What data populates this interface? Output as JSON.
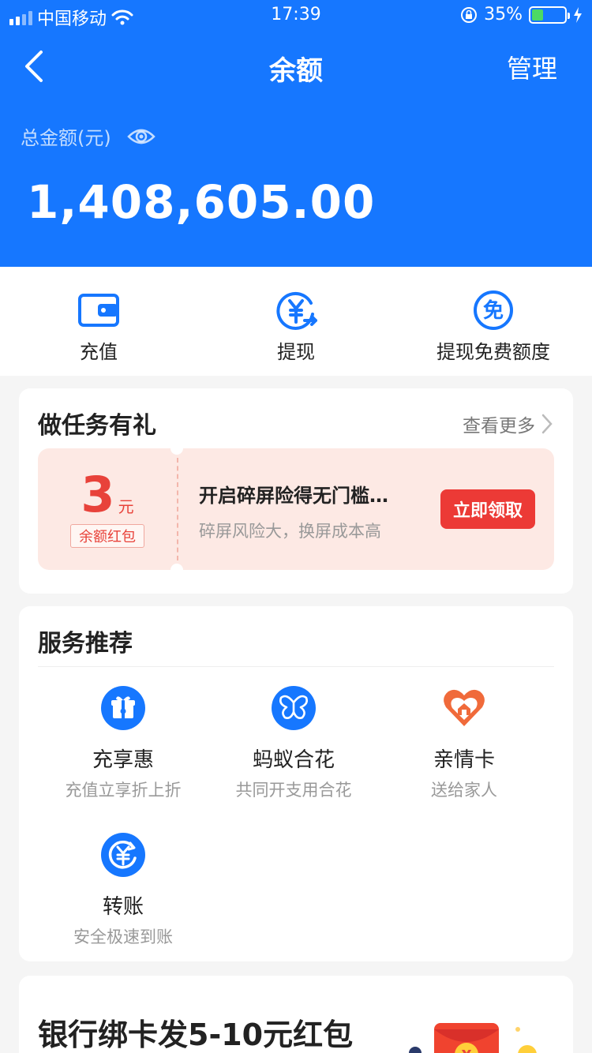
{
  "status_bar": {
    "carrier": "中国移动",
    "time": "17:39",
    "battery_percent": "35%",
    "battery_level": 0.35
  },
  "nav": {
    "title": "余额",
    "manage_label": "管理"
  },
  "balance": {
    "label": "总金额(元)",
    "amount": "1,408,605.00"
  },
  "actions": [
    {
      "label": "充值",
      "icon": "wallet-icon"
    },
    {
      "label": "提现",
      "icon": "yuan-withdraw-icon"
    },
    {
      "label": "提现免费额度",
      "icon": "free-icon"
    }
  ],
  "tasks": {
    "title": "做任务有礼",
    "more_label": "查看更多",
    "coupon": {
      "amount": "3",
      "unit": "元",
      "tag": "余额红包",
      "title": "开启碎屏险得无门槛…",
      "subtitle": "碎屏风险大，换屏成本高",
      "button": "立即领取"
    }
  },
  "services": {
    "title": "服务推荐",
    "items": [
      {
        "name": "充享惠",
        "desc": "充值立享折上折",
        "icon": "gift-icon",
        "color": "#1677ff"
      },
      {
        "name": "蚂蚁合花",
        "desc": "共同开支用合花",
        "icon": "butterfly-icon",
        "color": "#1677ff"
      },
      {
        "name": "亲情卡",
        "desc": "送给家人",
        "icon": "heart-home-icon",
        "color": "#f06a3a"
      },
      {
        "name": "转账",
        "desc": "安全极速到账",
        "icon": "transfer-yuan-icon",
        "color": "#1677ff"
      }
    ]
  },
  "bank_promo": {
    "title": "银行绑卡发5-10元红包"
  },
  "colors": {
    "brand_blue": "#1677ff",
    "accent_red": "#ec3a36",
    "coupon_bg": "#fde9e4"
  }
}
